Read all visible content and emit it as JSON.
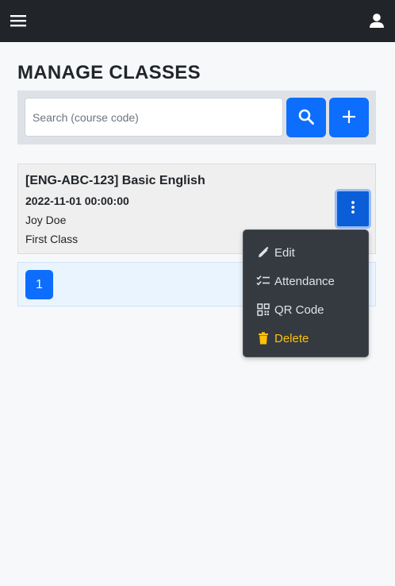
{
  "header": {
    "menu_icon": "hamburger-menu-icon",
    "user_icon": "user-account-icon"
  },
  "page": {
    "title": "MANAGE CLASSES"
  },
  "search": {
    "placeholder": "Search (course code)",
    "value": "",
    "search_icon": "search-icon",
    "add_icon": "plus-icon"
  },
  "classes": [
    {
      "title": "[ENG-ABC-123] Basic English",
      "datetime": "2022-11-01 00:00:00",
      "teacher": "Joy Doe",
      "name": "First Class",
      "menu_icon": "kebab-menu-icon"
    }
  ],
  "pagination": {
    "current_page": "1"
  },
  "dropdown": {
    "items": [
      {
        "label": "Edit",
        "icon": "pencil-icon"
      },
      {
        "label": "Attendance",
        "icon": "checklist-icon"
      },
      {
        "label": "QR Code",
        "icon": "qr-code-icon"
      },
      {
        "label": "Delete",
        "icon": "trash-icon"
      }
    ]
  },
  "colors": {
    "navbar": "#212529",
    "primary": "#0d6efd",
    "dropdown_bg": "#343a40",
    "delete_text": "#ffc107"
  }
}
